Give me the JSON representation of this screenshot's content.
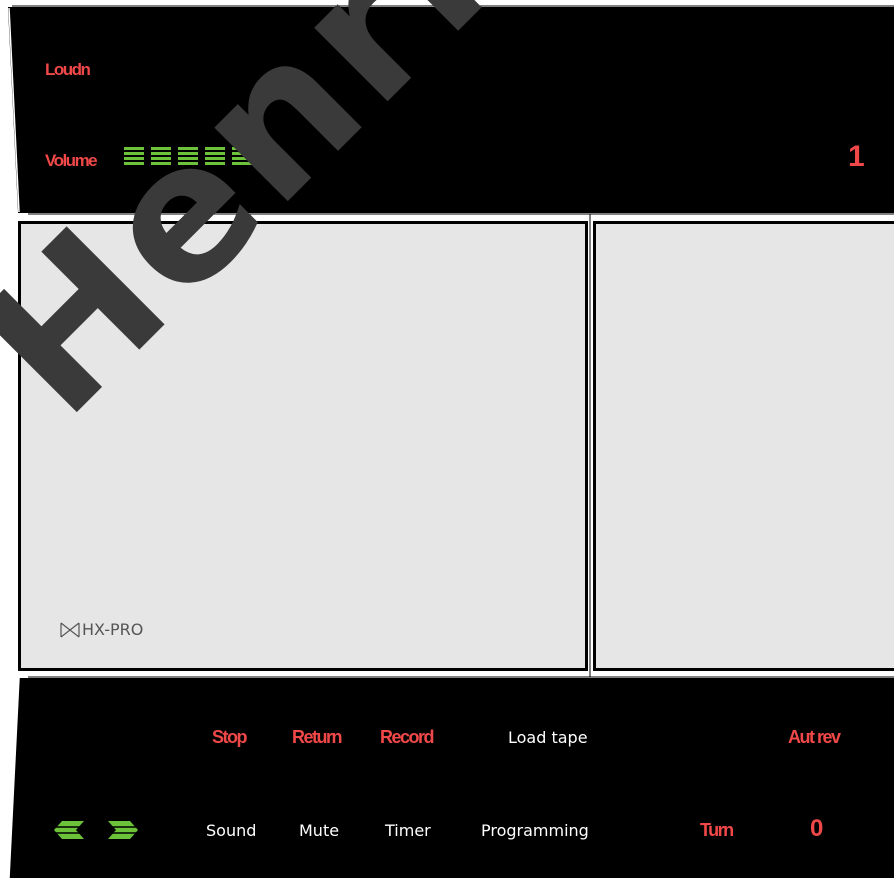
{
  "display": {
    "loudness_label": "Loudn",
    "volume_label": "Volume",
    "volume_level_bars": 5,
    "track_number": "1"
  },
  "cassette": {
    "hx_pro_label": "HX-PRO"
  },
  "controls": {
    "stop": "Stop",
    "return": "Return",
    "record": "Record",
    "load_tape": "Load tape",
    "auto_reverse": "Aut rev",
    "sound": "Sound",
    "mute": "Mute",
    "timer": "Timer",
    "programming": "Programming",
    "turn": "Turn",
    "counter": "0"
  },
  "watermark": "Henriksens ELEK",
  "colors": {
    "panel": "#000000",
    "indicator_red": "#f04848",
    "indicator_green": "#6cc33a",
    "window_gray": "#e6e6e6"
  },
  "icons": [
    "hx-pro-logo-icon",
    "rewind-arrow-icon",
    "forward-arrow-icon"
  ]
}
